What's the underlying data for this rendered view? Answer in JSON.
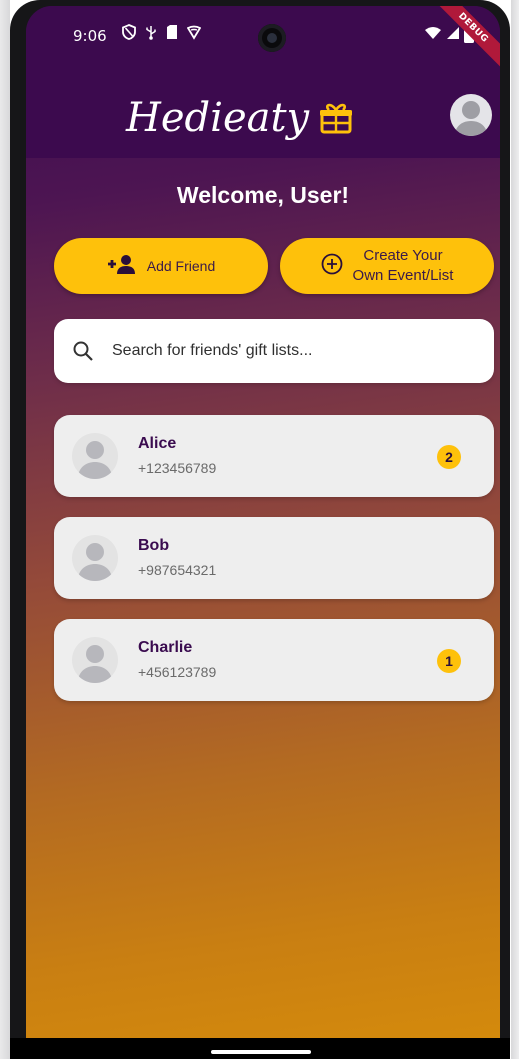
{
  "status_bar": {
    "time": "9:06",
    "debug_label": "DEBUG"
  },
  "app_bar": {
    "title": "Hedieaty"
  },
  "welcome": "Welcome, User!",
  "actions": {
    "add_friend": "Add Friend",
    "create_event": "Create Your\nOwn Event/List"
  },
  "search": {
    "placeholder": "Search for friends' gift lists..."
  },
  "friends": [
    {
      "name": "Alice",
      "phone": "+123456789",
      "badge": "2"
    },
    {
      "name": "Bob",
      "phone": "+987654321",
      "badge": ""
    },
    {
      "name": "Charlie",
      "phone": "+456123789",
      "badge": "1"
    }
  ],
  "colors": {
    "app_bar": "#3c0a4e",
    "accent": "#fec10b",
    "name_text": "#3a0b4f",
    "card": "#eeeeee"
  },
  "icons": {
    "brand": "gift-icon",
    "profile": "person-avatar-icon",
    "add_friend": "person-add-icon",
    "create_event": "add-circle-outline-icon",
    "search": "search-icon"
  }
}
